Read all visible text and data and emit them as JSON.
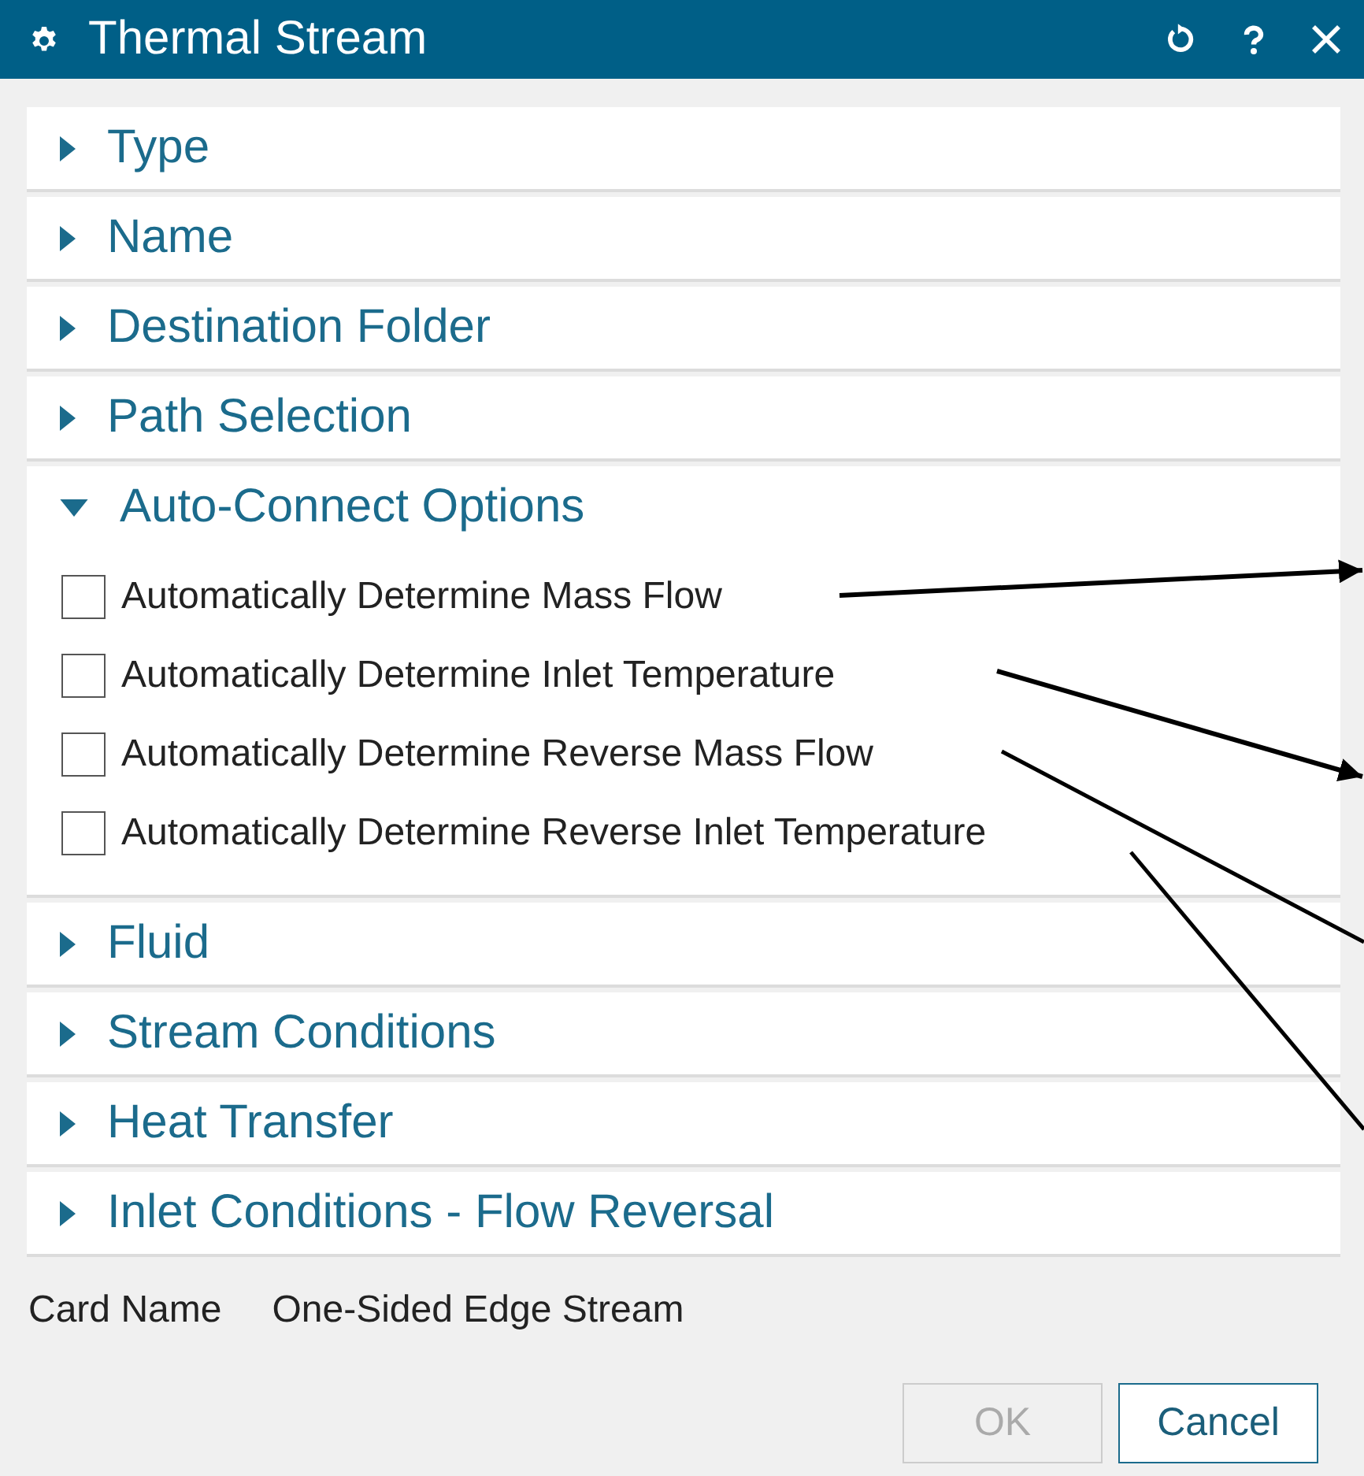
{
  "window": {
    "title": "Thermal Stream"
  },
  "sections": [
    {
      "title": "Type",
      "expanded": false
    },
    {
      "title": "Name",
      "expanded": false
    },
    {
      "title": "Destination Folder",
      "expanded": false
    },
    {
      "title": "Path Selection",
      "expanded": false
    },
    {
      "title": "Auto-Connect Options",
      "expanded": true,
      "options": [
        {
          "label": "Automatically Determine Mass Flow",
          "checked": false
        },
        {
          "label": "Automatically Determine Inlet Temperature",
          "checked": false
        },
        {
          "label": "Automatically Determine Reverse Mass Flow",
          "checked": false
        },
        {
          "label": "Automatically Determine Reverse Inlet Temperature",
          "checked": false
        }
      ]
    },
    {
      "title": "Fluid",
      "expanded": false
    },
    {
      "title": "Stream Conditions",
      "expanded": false
    },
    {
      "title": "Heat Transfer",
      "expanded": false
    },
    {
      "title": "Inlet Conditions - Flow Reversal",
      "expanded": false
    }
  ],
  "card_name": {
    "label": "Card Name",
    "value": "One-Sided Edge Stream"
  },
  "buttons": [
    {
      "label": "OK",
      "disabled": true
    },
    {
      "label": "Cancel",
      "disabled": false
    }
  ]
}
